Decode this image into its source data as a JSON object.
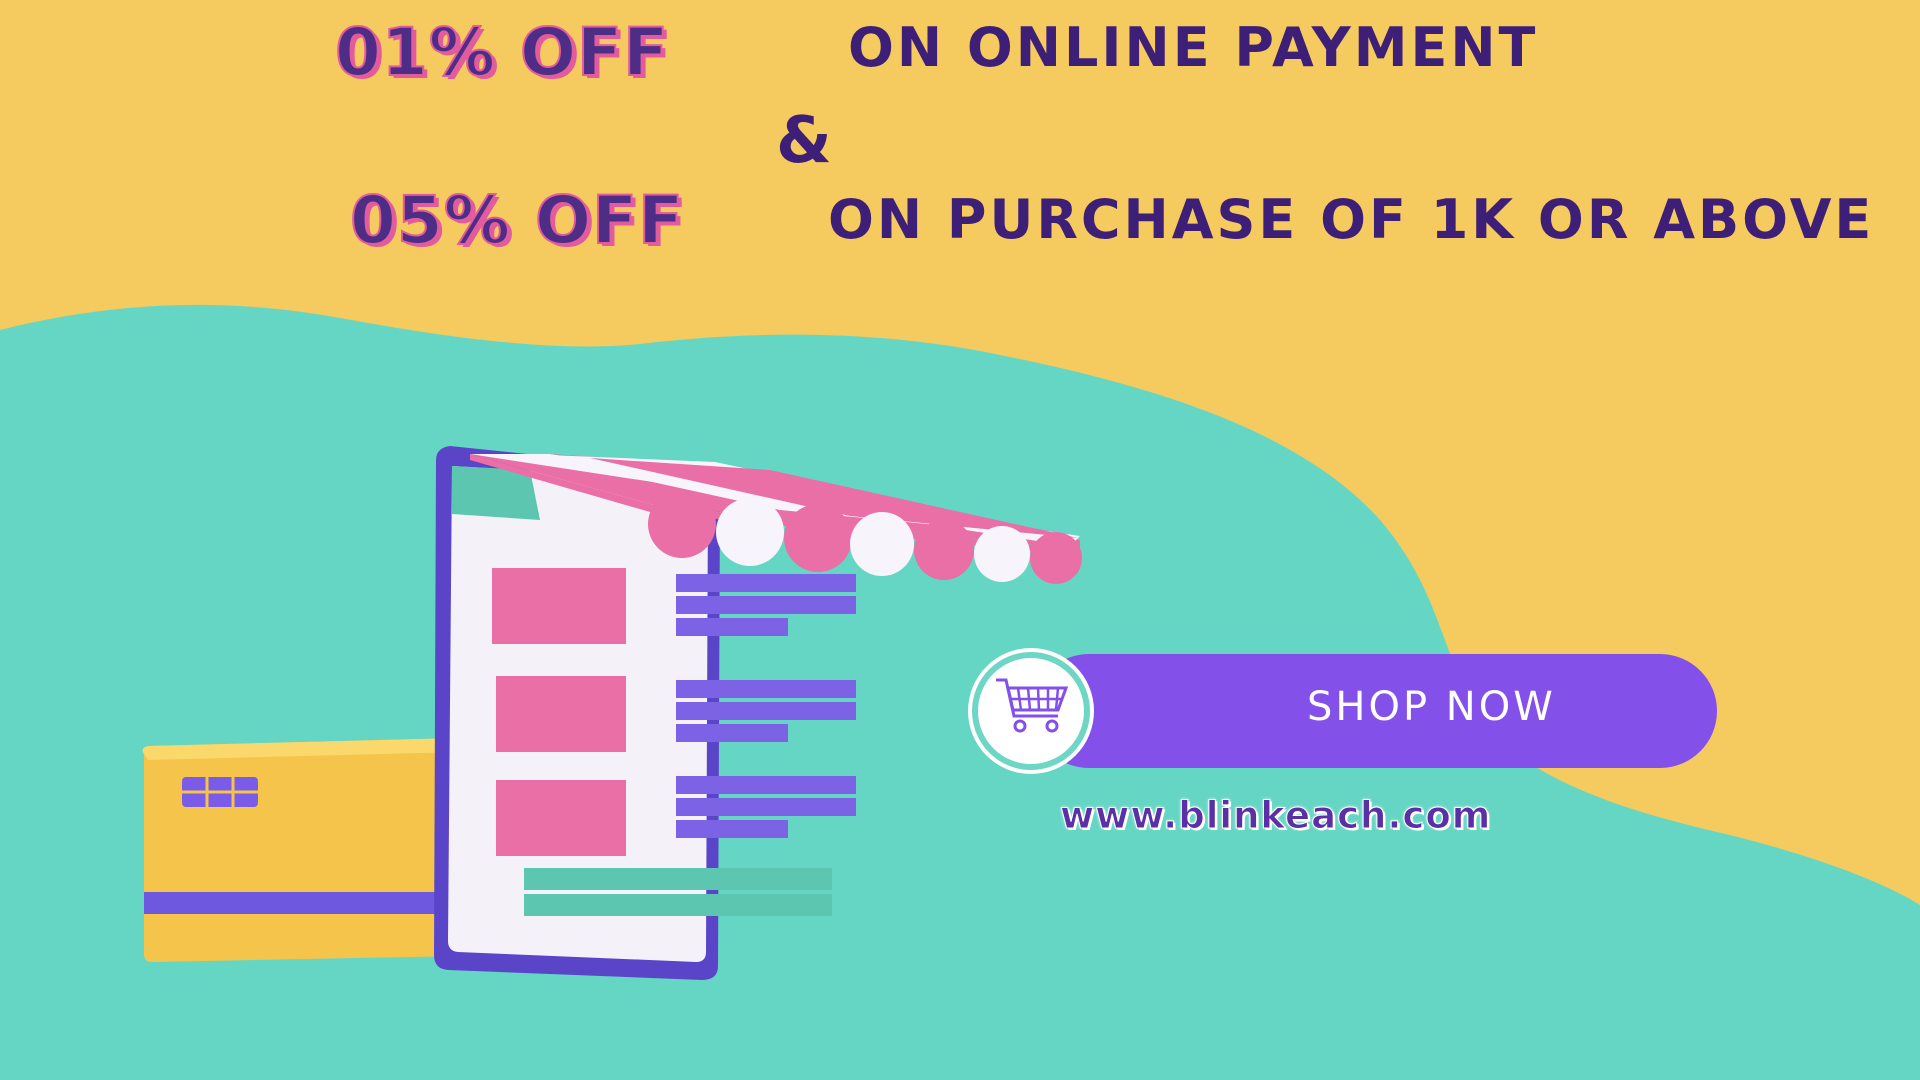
{
  "colors": {
    "yellow_bg": "#f5ca5e",
    "teal_bg": "#66d6c4",
    "purple": "#8350ea",
    "pink": "#e25b9c",
    "dark_text": "#3d1f78"
  },
  "headline": {
    "offer1": "01% OFF",
    "desc1": "ON ONLINE PAYMENT",
    "ampersand": "&",
    "offer2": "05% OFF",
    "desc2": "ON PURCHASE OF 1K OR ABOVE"
  },
  "cta": {
    "label": "SHOP NOW",
    "icon": "shopping-cart-icon"
  },
  "website": "www.blinkeach.com",
  "illustration": {
    "phone_icon": "shop-phone-illustration",
    "card_icon": "credit-card-illustration"
  }
}
